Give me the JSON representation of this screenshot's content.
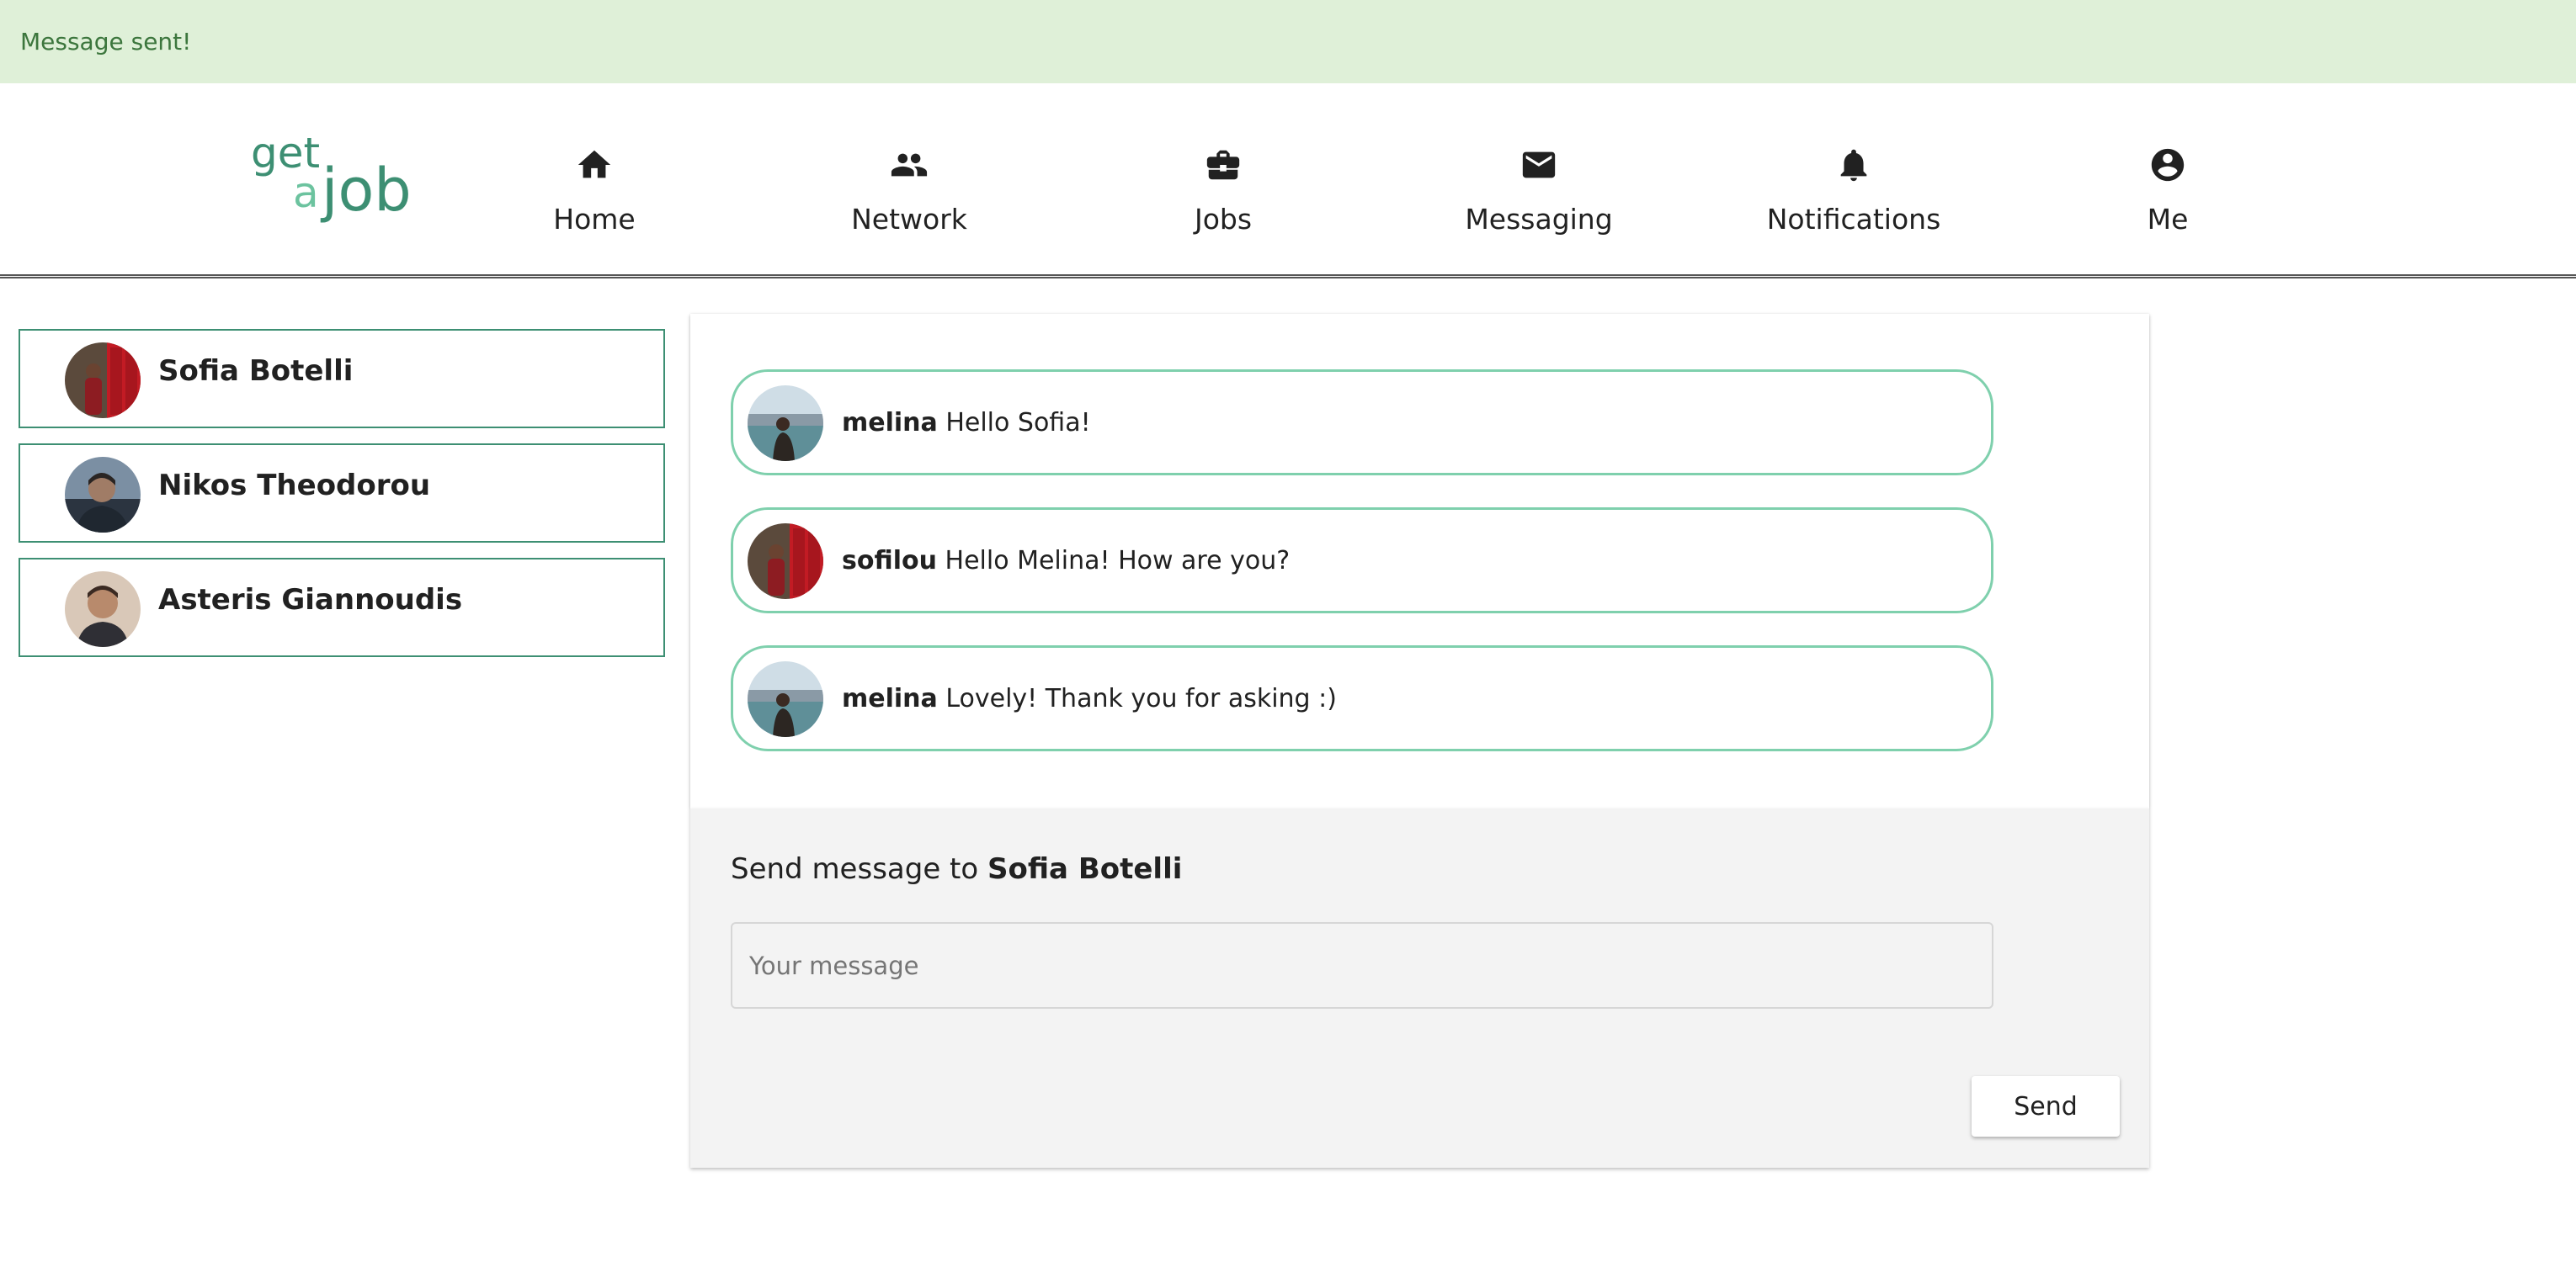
{
  "alert": {
    "text": "Message sent!"
  },
  "logo": {
    "get": "get",
    "a": "a",
    "job": "job"
  },
  "nav": [
    {
      "label": "Home",
      "icon": "home-icon"
    },
    {
      "label": "Network",
      "icon": "people-icon"
    },
    {
      "label": "Jobs",
      "icon": "briefcase-icon"
    },
    {
      "label": "Messaging",
      "icon": "mail-icon"
    },
    {
      "label": "Notifications",
      "icon": "bell-icon"
    },
    {
      "label": "Me",
      "icon": "account-circle-icon"
    }
  ],
  "conversations": [
    {
      "name": "Sofia Botelli"
    },
    {
      "name": "Nikos Theodorou"
    },
    {
      "name": "Asteris Giannoudis"
    }
  ],
  "messages": [
    {
      "user": "melina",
      "text": "Hello Sofia!"
    },
    {
      "user": "sofilou",
      "text": "Hello Melina! How are you?"
    },
    {
      "user": "melina",
      "text": "Lovely! Thank you for asking :)"
    }
  ],
  "compose": {
    "heading_prefix": "Send message to",
    "recipient": "Sofia Botelli",
    "placeholder": "Your message",
    "value": "",
    "send_label": "Send"
  },
  "colors": {
    "brand": "#3d8f73",
    "brand_light": "#6cc39f",
    "message_border": "#7fd0ad",
    "alert_bg": "#dff0d8",
    "alert_text": "#3c763d"
  }
}
